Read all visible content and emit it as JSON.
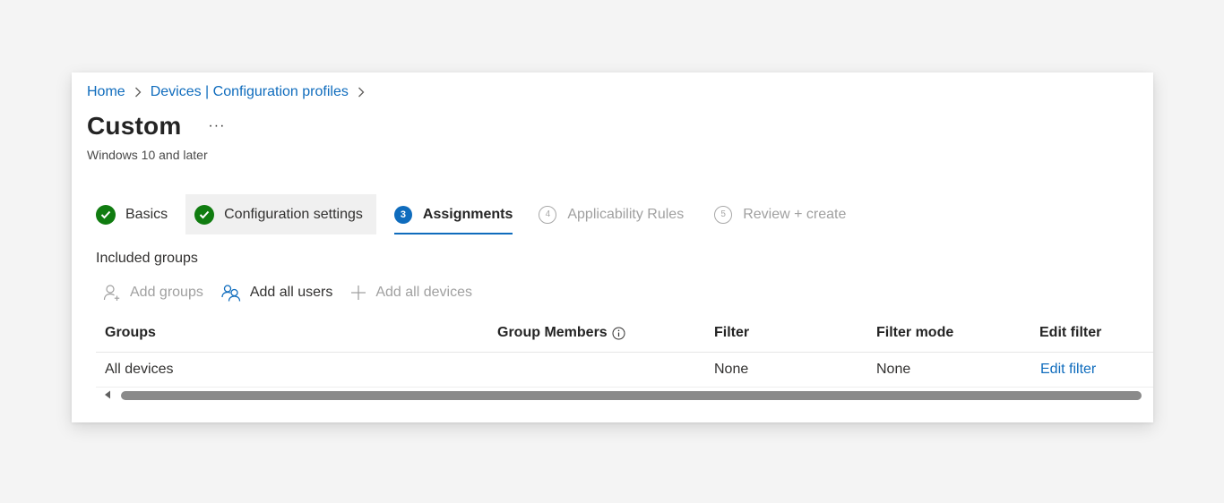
{
  "breadcrumb": {
    "items": [
      "Home",
      "Devices | Configuration profiles"
    ]
  },
  "page": {
    "title": "Custom",
    "more_label": "···",
    "subtitle": "Windows 10 and later"
  },
  "steps": [
    {
      "label": "Basics",
      "state": "complete"
    },
    {
      "label": "Configuration settings",
      "state": "complete"
    },
    {
      "number": "3",
      "label": "Assignments",
      "state": "active"
    },
    {
      "number": "4",
      "label": "Applicability Rules",
      "state": "disabled"
    },
    {
      "number": "5",
      "label": "Review + create",
      "state": "disabled"
    }
  ],
  "section": {
    "included_groups_label": "Included groups"
  },
  "toolbar": {
    "add_groups": "Add groups",
    "add_all_users": "Add all users",
    "add_all_devices": "Add all devices"
  },
  "table": {
    "headers": [
      "Groups",
      "Group Members",
      "Filter",
      "Filter mode",
      "Edit filter"
    ],
    "rows": [
      {
        "group": "All devices",
        "group_members": "",
        "filter": "None",
        "filter_mode": "None",
        "edit_filter": "Edit filter"
      }
    ]
  },
  "colors": {
    "accent": "#0f6cbd",
    "success": "#107c10",
    "disabled_text": "#a0a0a0",
    "background": "#f4f4f4"
  },
  "icons": {
    "breadcrumb_separator": "chevron-right-icon",
    "step_complete": "check-circle-icon",
    "add_groups": "person-add-icon",
    "add_all_users": "people-icon",
    "add_all_devices": "plus-icon",
    "group_members_info": "info-icon",
    "scroll_left": "caret-left-icon"
  }
}
